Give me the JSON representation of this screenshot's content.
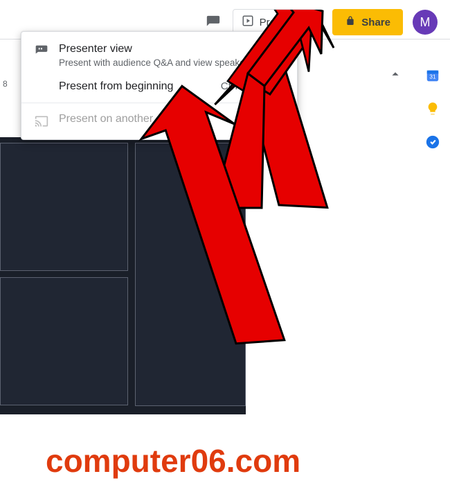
{
  "toolbar": {
    "present_label": "Present",
    "share_label": "Share",
    "avatar_initial": "M"
  },
  "dropdown": {
    "items": [
      {
        "title": "Presenter view",
        "subtitle": "Present with audience Q&A and view speaker notes",
        "shortcut": ""
      },
      {
        "title": "Present from beginning",
        "subtitle": "",
        "shortcut": "Ctrl+Shift+F5"
      },
      {
        "title": "Present on another screen...",
        "subtitle": "",
        "shortcut": ""
      }
    ]
  },
  "ruler": {
    "tick_label": "8"
  },
  "watermark": "computer06.com"
}
